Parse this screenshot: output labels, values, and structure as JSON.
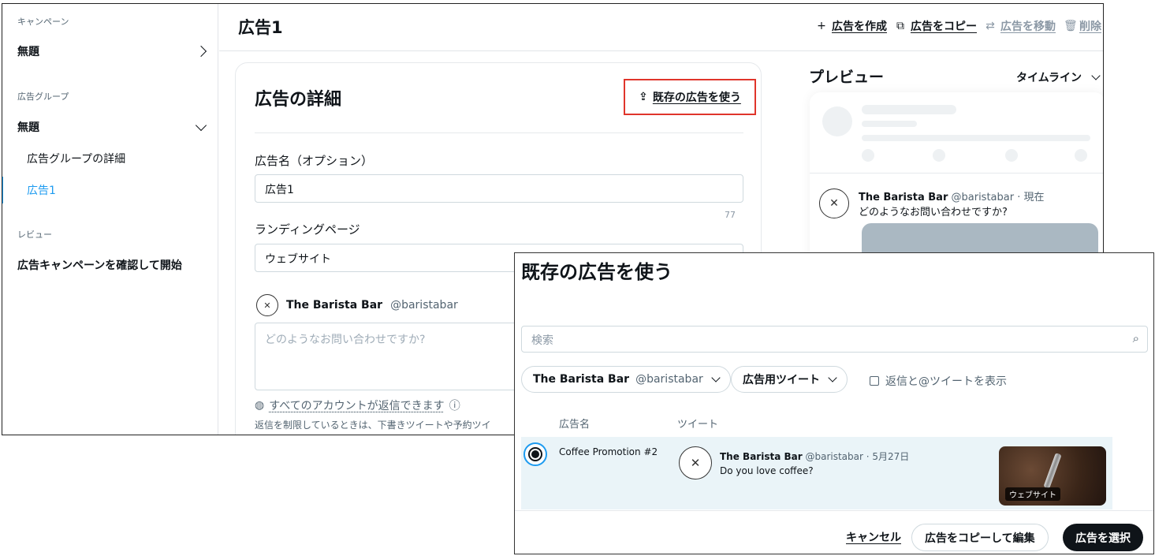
{
  "sidebar": {
    "campaign_section": "キャンペーン",
    "campaign_item": "無題",
    "adgroup_section": "広告グループ",
    "adgroup_item": "無題",
    "adgroup_details": "広告グループの詳細",
    "ad_item": "広告1",
    "review_section": "レビュー",
    "review_item": "広告キャンペーンを確認して開始"
  },
  "header": {
    "title": "広告1",
    "actions": {
      "create": "広告を作成",
      "copy": "広告をコピー",
      "move": "広告を移動",
      "delete": "削除"
    }
  },
  "details": {
    "title": "広告の詳細",
    "use_existing": "既存の広告を使う",
    "name_label": "広告名（オプション）",
    "name_value": "広告1",
    "name_counter": "77",
    "landing_label": "ランディングページ",
    "landing_value": "ウェブサイト",
    "account_name": "The Barista Bar",
    "account_handle": "@baristabar",
    "tweet_placeholder": "どのようなお問い合わせですか?",
    "reply_setting": "すべてのアカウントが返信できます",
    "reply_note": "返信を制限しているときは、下書きツイートや予約ツイ"
  },
  "preview": {
    "title": "プレビュー",
    "placement": "タイムライン",
    "tweet_name": "The Barista Bar",
    "tweet_handle": "@baristabar · 現在",
    "tweet_text": "どのようなお問い合わせですか?"
  },
  "modal": {
    "title": "既存の広告を使う",
    "search_placeholder": "検索",
    "account_filter_name": "The Barista Bar",
    "account_filter_handle": "@baristabar",
    "type_filter": "広告用ツイート",
    "show_replies": "返信と@ツイートを表示",
    "col_name": "広告名",
    "col_tweet": "ツイート",
    "row": {
      "name": "Coffee Promotion #2",
      "account": "The Barista Bar",
      "meta": "@baristabar · 5月27日",
      "text": "Do you love coffee?",
      "media_label": "ウェブサイト"
    },
    "cancel": "キャンセル",
    "copy_edit": "広告をコピーして編集",
    "select": "広告を選択"
  }
}
